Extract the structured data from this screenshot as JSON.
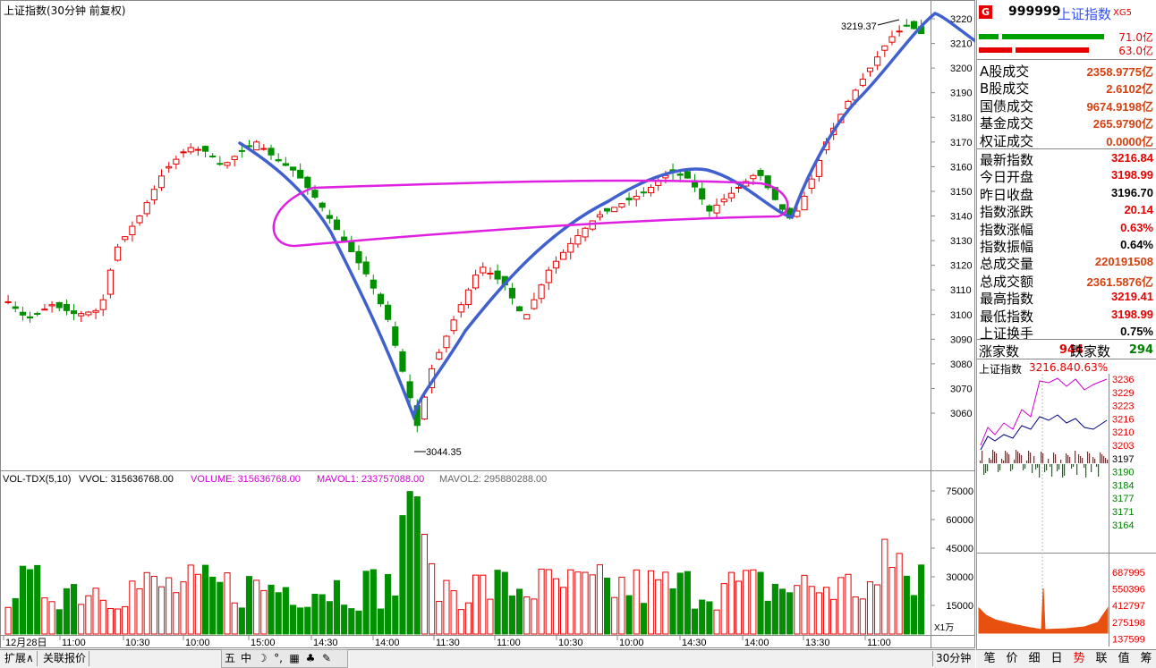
{
  "chart_title": "上证指数(30分钟 前复权)",
  "price_axis": [
    "3220",
    "3210",
    "3200",
    "3190",
    "3180",
    "3170",
    "3160",
    "3150",
    "3140",
    "3130",
    "3120",
    "3110",
    "3100",
    "3090",
    "3080",
    "3070",
    "3060"
  ],
  "high_label": "3219.37",
  "low_label": "3044.35",
  "vol_header": {
    "name": "VOL-TDX(5,10)",
    "vvol": "VVOL: 315636768.00",
    "volume": "VOLUME: 315636768.00",
    "mavol1": "MAVOL1: 233757088.00",
    "mavol2": "MAVOL2: 295880288.00"
  },
  "vol_axis": [
    "75000",
    "60000",
    "45000",
    "30000",
    "15000"
  ],
  "vol_unit": "X1万",
  "time_axis": [
    "12月28日",
    "11:00",
    "10:30",
    "10:00",
    "15:00",
    "14:30",
    "14:00",
    "11:30",
    "11:00",
    "10:30",
    "10:00",
    "14:30",
    "14:00",
    "13:30",
    "11:00"
  ],
  "period": "30分钟",
  "bottom_tabs": [
    "扩展∧",
    "关联报价"
  ],
  "toolbar_icons": [
    "五",
    "中",
    "☽",
    "°,",
    "▦",
    "♣",
    "✎"
  ],
  "right_panel": {
    "logo": "G",
    "code": "999999",
    "name": "上证指数",
    "tag": "XG5",
    "buy_amount": "71.0亿",
    "sell_amount": "63.0亿",
    "rows": [
      {
        "label": "A股成交",
        "value": "2358.9775亿",
        "color": "#d4400f"
      },
      {
        "label": "B股成交",
        "value": "2.6102亿",
        "color": "#d4400f"
      },
      {
        "label": "国债成交",
        "value": "9674.9198亿",
        "color": "#d4400f"
      },
      {
        "label": "基金成交",
        "value": "265.9790亿",
        "color": "#d4400f"
      },
      {
        "label": "权证成交",
        "value": "0.0000亿",
        "color": "#d4400f"
      },
      {
        "label": "最新指数",
        "value": "3216.84",
        "color": "#e60000"
      },
      {
        "label": "今日开盘",
        "value": "3198.99",
        "color": "#e60000"
      },
      {
        "label": "昨日收盘",
        "value": "3196.70",
        "color": "#000000"
      },
      {
        "label": "指数涨跌",
        "value": "20.14",
        "color": "#e60000"
      },
      {
        "label": "指数涨幅",
        "value": "0.63%",
        "color": "#e60000"
      },
      {
        "label": "指数振幅",
        "value": "0.64%",
        "color": "#000000"
      },
      {
        "label": "总成交量",
        "value": "220191508",
        "color": "#d4400f"
      },
      {
        "label": "总成交额",
        "value": "2361.5876亿",
        "color": "#d4400f"
      },
      {
        "label": "最高指数",
        "value": "3219.41",
        "color": "#e60000"
      },
      {
        "label": "最低指数",
        "value": "3198.99",
        "color": "#e60000"
      },
      {
        "label": "上证换手",
        "value": "0.75%",
        "color": "#000000"
      }
    ],
    "rise_label": "涨家数",
    "rise_value": "944",
    "fall_label": "跌家数",
    "fall_value": "294",
    "mini_title": "上证指数",
    "mini_price": "3216.84",
    "mini_pct": "0.63%",
    "mini_price_axis": [
      "3236",
      "3229",
      "3223",
      "3216",
      "3210",
      "3203",
      "3197",
      "3190",
      "3184",
      "3177",
      "3171",
      "3164"
    ],
    "mini_vol_axis": [
      "687995",
      "550396",
      "412797",
      "275198",
      "137599"
    ],
    "tabs": [
      "笔",
      "价",
      "细",
      "日",
      "势",
      "联",
      "值",
      "筹"
    ]
  }
}
